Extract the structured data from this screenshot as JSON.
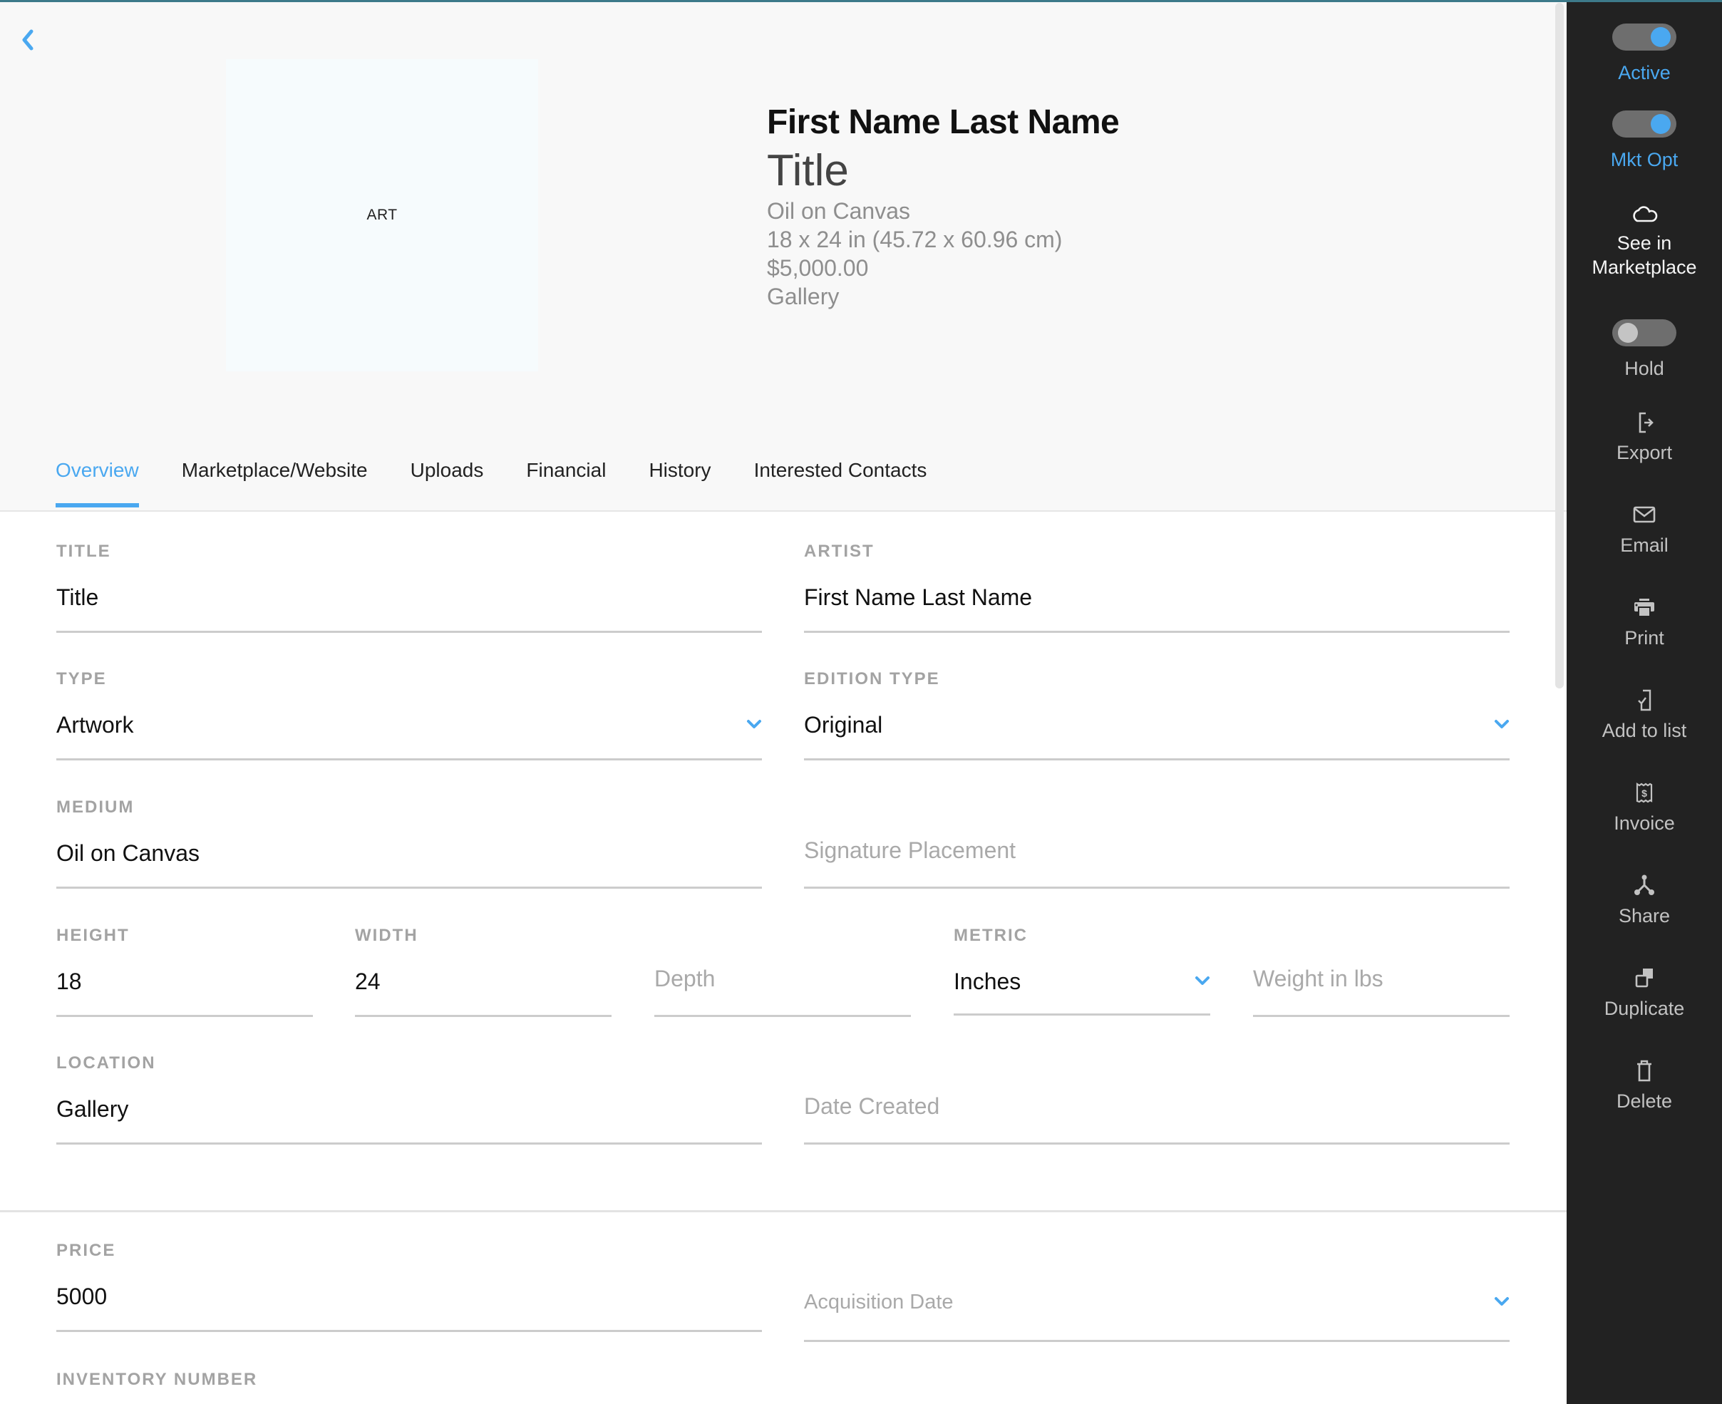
{
  "header": {
    "back_label": "Back",
    "art_placeholder": "ART",
    "artist": "First Name Last Name",
    "title": "Title",
    "medium": "Oil on Canvas",
    "dimensions": "18 x 24 in (45.72 x 60.96 cm)",
    "price": "$5,000.00",
    "location": "Gallery"
  },
  "tabs": [
    {
      "label": "Overview",
      "active": true
    },
    {
      "label": "Marketplace/Website"
    },
    {
      "label": "Uploads"
    },
    {
      "label": "Financial"
    },
    {
      "label": "History"
    },
    {
      "label": "Interested Contacts"
    }
  ],
  "form": {
    "title": {
      "label": "TITLE",
      "value": "Title"
    },
    "artist": {
      "label": "ARTIST",
      "value": "First Name Last Name"
    },
    "type": {
      "label": "TYPE",
      "value": "Artwork"
    },
    "edition_type": {
      "label": "EDITION TYPE",
      "value": "Original"
    },
    "medium": {
      "label": "MEDIUM",
      "value": "Oil on Canvas"
    },
    "signature_placement": {
      "placeholder": "Signature Placement"
    },
    "height": {
      "label": "HEIGHT",
      "value": "18"
    },
    "width": {
      "label": "WIDTH",
      "value": "24"
    },
    "depth": {
      "placeholder": "Depth"
    },
    "metric": {
      "label": "METRIC",
      "value": "Inches"
    },
    "weight": {
      "placeholder": "Weight in lbs"
    },
    "location": {
      "label": "LOCATION",
      "value": "Gallery"
    },
    "date_created": {
      "placeholder": "Date Created"
    },
    "price": {
      "label": "PRICE",
      "value": "5000"
    },
    "acquisition_date": {
      "placeholder": "Acquisition Date"
    },
    "inventory_number": {
      "label": "INVENTORY NUMBER"
    }
  },
  "sidebar": {
    "active": {
      "label": "Active",
      "on": true
    },
    "mkt_opt": {
      "label": "Mkt Opt",
      "on": true
    },
    "see_in_marketplace": {
      "label_line1": "See in",
      "label_line2": "Marketplace"
    },
    "hold": {
      "label": "Hold",
      "on": false
    },
    "export": {
      "label": "Export"
    },
    "email": {
      "label": "Email"
    },
    "print": {
      "label": "Print"
    },
    "add_to_list": {
      "label": "Add to list"
    },
    "invoice": {
      "label": "Invoice"
    },
    "share": {
      "label": "Share"
    },
    "duplicate": {
      "label": "Duplicate"
    },
    "delete": {
      "label": "Delete"
    }
  },
  "colors": {
    "accent": "#4aa8f0",
    "sidebar_bg": "#222222",
    "header_bg": "#f8f8f8",
    "top_border": "#3d7a8a"
  }
}
